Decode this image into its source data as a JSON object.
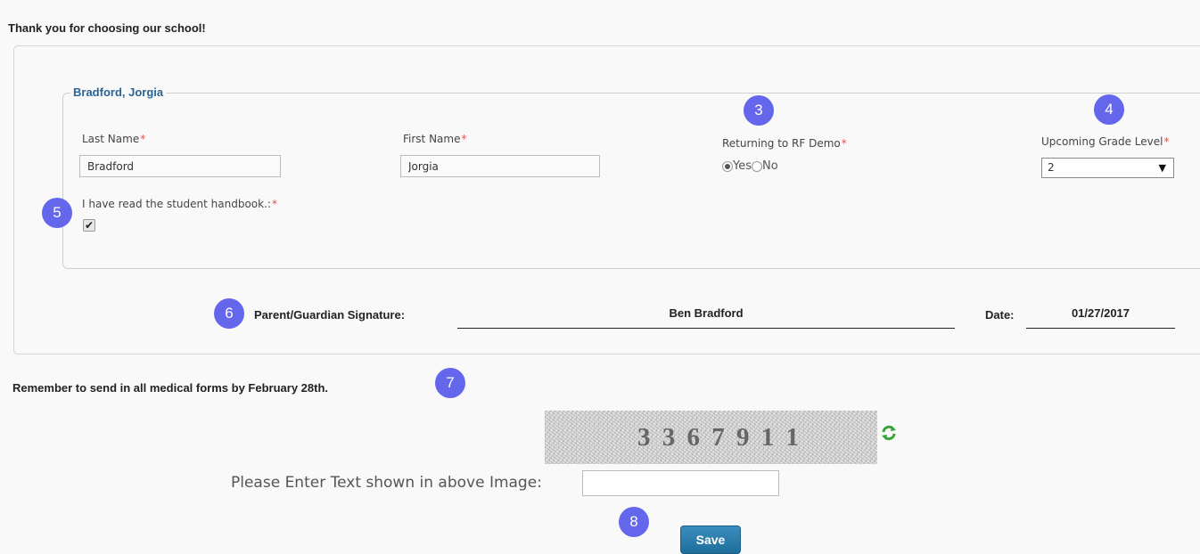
{
  "intro": "Thank you for choosing our school!",
  "student": {
    "legend": "Bradford, Jorgia",
    "last_name_label": "Last Name",
    "last_name_value": "Bradford",
    "first_name_label": "First Name",
    "first_name_value": "Jorgia",
    "returning_label": "Returning to RF Demo",
    "returning_options": [
      "Yes",
      "No"
    ],
    "returning_selected": "Yes",
    "grade_label": "Upcoming Grade Level",
    "grade_value": "2",
    "handbook_label": "I have read the student handbook.:",
    "handbook_checked": true,
    "required_mark": "*"
  },
  "signature": {
    "label": "Parent/Guardian Signature:",
    "value": "Ben Bradford",
    "date_label": "Date:",
    "date_value": "01/27/2017"
  },
  "reminder": "Remember to send in all medical forms by February 28th.",
  "captcha": {
    "image_text": "3 3 6 7 9 1 1",
    "prompt": "Please Enter Text shown in above Image:",
    "input_value": "",
    "refresh_icon": "refresh-icon"
  },
  "save_label": "Save",
  "markers": [
    "3",
    "4",
    "5",
    "6",
    "7",
    "8"
  ],
  "colors": {
    "marker": "#6466ec",
    "legend": "#2a6496",
    "required": "#d9534f",
    "save_button": "#2a7fb0"
  }
}
